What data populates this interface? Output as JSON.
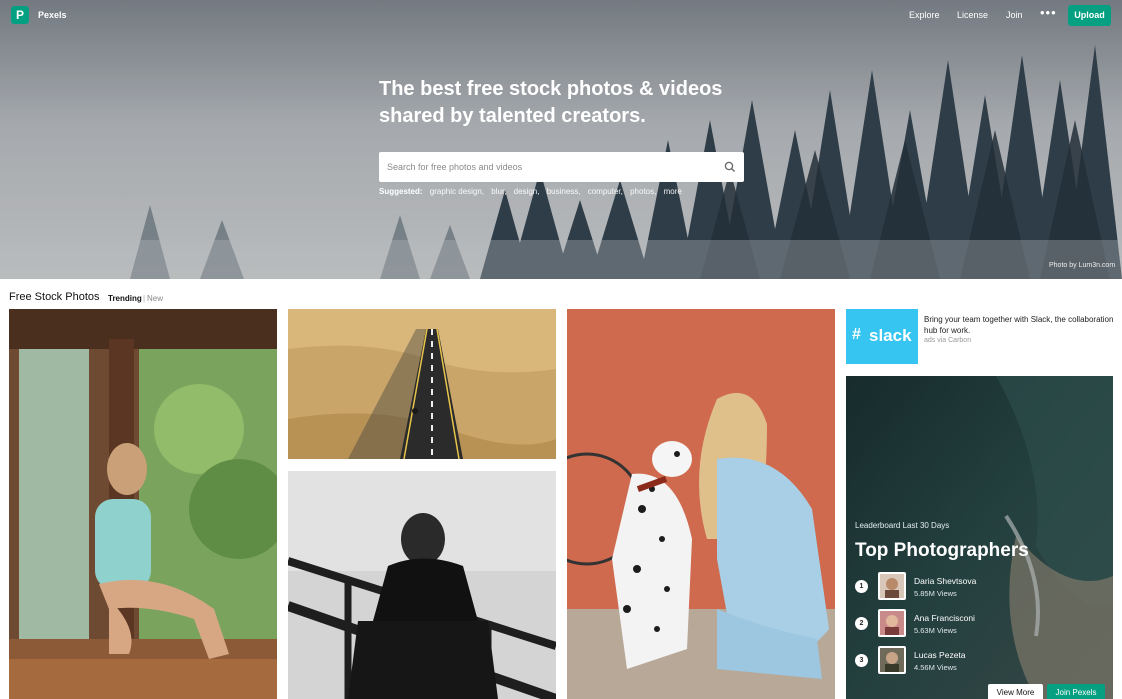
{
  "nav": {
    "logo_letter": "P",
    "brand": "Pexels",
    "links": [
      "Explore",
      "License",
      "Join"
    ],
    "more": "•••",
    "upload": "Upload"
  },
  "hero": {
    "title_line1": "The best free stock photos & videos",
    "title_line2": "shared by talented creators.",
    "search_placeholder": "Search for free photos and videos",
    "suggested_label": "Suggested:",
    "suggested_tags": [
      "graphic design,",
      "blur,",
      "design,",
      "business,",
      "computer,",
      "photos,",
      "more"
    ],
    "credit": "Photo by Lum3n.com"
  },
  "section": {
    "title": "Free Stock Photos",
    "tab_trending": "Trending",
    "separator": "|",
    "tab_new": "New"
  },
  "ad": {
    "brand": "slack",
    "text": "Bring your team together with Slack, the collaboration hub for work.",
    "via": "ads via Carbon"
  },
  "leaderboard": {
    "subtitle": "Leaderboard Last 30 Days",
    "title": "Top Photographers",
    "photographers": [
      {
        "rank": "1",
        "name": "Daria Shevtsova",
        "views": "5.85M Views"
      },
      {
        "rank": "2",
        "name": "Ana Francisconi",
        "views": "5.63M Views"
      },
      {
        "rank": "3",
        "name": "Lucas Pezeta",
        "views": "4.56M Views"
      }
    ],
    "view_more": "View More",
    "join": "Join Pexels"
  },
  "colors": {
    "brand_green": "#05a081",
    "slack_blue": "#36c5f0"
  }
}
